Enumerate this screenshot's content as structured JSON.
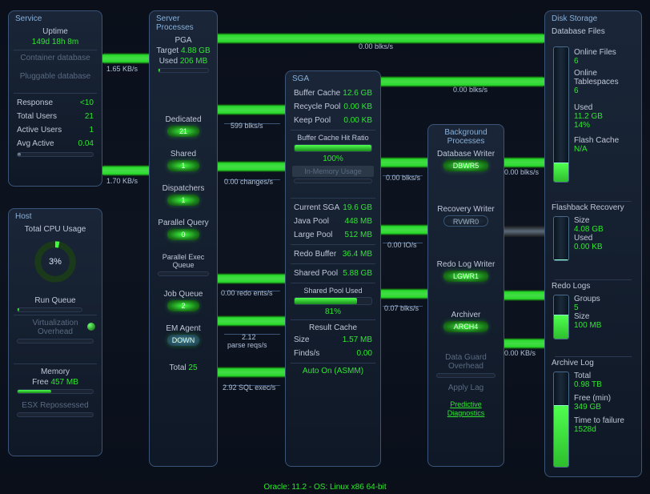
{
  "service": {
    "title": "Service",
    "uptime_label": "Uptime",
    "uptime": "149d 18h 8m",
    "container_db": "Container database",
    "pluggable_db": "Pluggable database",
    "response_label": "Response",
    "response": "<10",
    "total_users_label": "Total Users",
    "total_users": "21",
    "active_users_label": "Active Users",
    "active_users": "1",
    "avg_active_label": "Avg Active",
    "avg_active": "0.04"
  },
  "host": {
    "title": "Host",
    "cpu_label": "Total CPU Usage",
    "cpu_pct": "3%",
    "run_queue": "Run Queue",
    "virt": "Virtualization Overhead",
    "memory": "Memory",
    "memory_free_label": "Free",
    "memory_free": "457 MB",
    "esx": "ESX Repossessed"
  },
  "server": {
    "title": "Server Processes",
    "pga": "PGA",
    "target_label": "Target",
    "target": "4.88 GB",
    "used_label": "Used",
    "used": "206 MB",
    "dedicated": "Dedicated",
    "dedicated_v": "21",
    "shared": "Shared",
    "shared_v": "1",
    "dispatchers": "Dispatchers",
    "dispatchers_v": "1",
    "parallel_query": "Parallel Query",
    "pq_v": "0",
    "parallel_exec": "Parallel Exec Queue",
    "job_queue": "Job Queue",
    "jq_v": "2",
    "em_agent": "EM Agent",
    "em_v": "DOWN",
    "total_label": "Total",
    "total": "25"
  },
  "sga": {
    "title": "SGA",
    "buffer_cache": "Buffer Cache",
    "buffer_cache_v": "12.6 GB",
    "recycle_pool": "Recycle Pool",
    "recycle_v": "0.00 KB",
    "keep_pool": "Keep Pool",
    "keep_v": "0.00 KB",
    "hit_ratio": "Buffer Cache Hit Ratio",
    "hit_v": "100%",
    "inmem": "In-Memory Usage",
    "current_sga": "Current SGA",
    "current_sga_v": "19.6 GB",
    "java_pool": "Java Pool",
    "java_pool_v": "448 MB",
    "large_pool": "Large Pool",
    "large_pool_v": "512 MB",
    "redo_buffer": "Redo Buffer",
    "redo_buffer_v": "36.4 MB",
    "shared_pool": "Shared Pool",
    "shared_pool_v": "5.88 GB",
    "shared_used": "Shared Pool Used",
    "shared_used_v": "81%",
    "result_cache": "Result Cache",
    "size_label": "Size",
    "size_v": "1.57 MB",
    "finds_label": "Finds/s",
    "finds_v": "0.00",
    "auto": "Auto On (ASMM)"
  },
  "bg": {
    "title": "Background Processes",
    "db_writer": "Database Writer",
    "db_writer_v": "DBWR5",
    "recovery": "Recovery Writer",
    "recovery_v": "RVWR0",
    "redo": "Redo Log Writer",
    "redo_v": "LGWR1",
    "archiver": "Archiver",
    "archiver_v": "ARCH4",
    "dg": "Data Guard Overhead",
    "apply": "Apply Lag",
    "predictive": "Predictive Diagnostics"
  },
  "disk": {
    "title": "Disk Storage",
    "db_files": "Database Files",
    "online_files": "Online Files",
    "online_files_v": "6",
    "online_ts": "Online Tablespaces",
    "online_ts_v": "6",
    "used": "Used",
    "used_v": "11.2 GB",
    "used_pct": "14%",
    "flash": "Flash Cache",
    "flash_v": "N/A",
    "fb": "Flashback Recovery",
    "fb_size": "Size",
    "fb_size_v": "4.08 GB",
    "fb_used": "Used",
    "fb_used_v": "0.00 KB",
    "redo": "Redo Logs",
    "groups": "Groups",
    "groups_v": "5",
    "redo_size": "Size",
    "redo_size_v": "100 MB",
    "archive": "Archive Log",
    "arch_total": "Total",
    "arch_total_v": "0.98 TB",
    "arch_free": "Free (min)",
    "arch_free_v": "349 GB",
    "ttf": "Time to failure",
    "ttf_v": "1528d"
  },
  "flows": {
    "f1": "1.65 KB/s",
    "f2": "1.70 KB/s",
    "f3": "599 blks/s",
    "f4": "0.00 changes/s",
    "f5": "0.00 redo ents/s",
    "f6": "2.12",
    "f6b": "parse reqs/s",
    "f7": "2.92 SQL exec/s",
    "f8": "0.00 blks/s",
    "f9": "0.00 blks/s",
    "f10": "0.00 blks/s",
    "f11": "0.00 IO/s",
    "f12": "0.07 blks/s",
    "f13": "0.00 blks/s",
    "f14": "0.00 KB/s"
  },
  "footer": "Oracle: 11.2 - OS: Linux x86 64-bit"
}
